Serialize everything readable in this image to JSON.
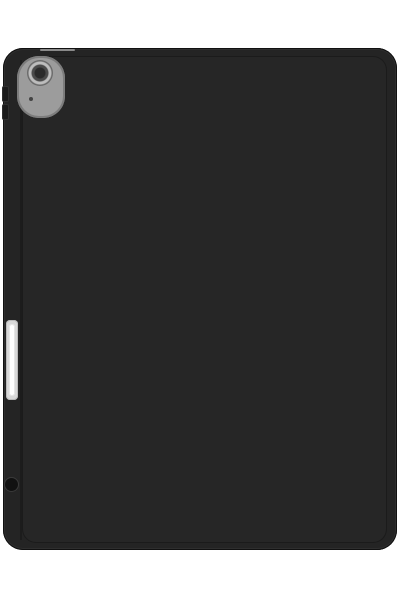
{
  "product": {
    "case_color": "#242424",
    "camera_ring_color": "#9c9c9c",
    "pencil_color": "#ffffff",
    "icons": [
      "camera-icon"
    ]
  }
}
